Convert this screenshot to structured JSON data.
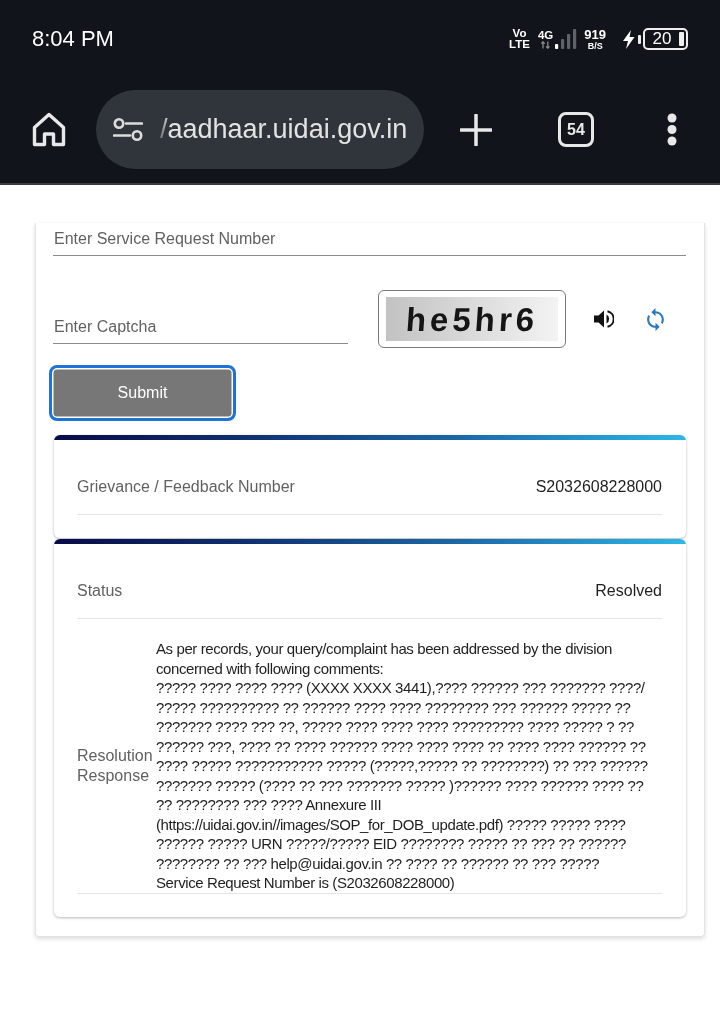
{
  "status_bar": {
    "time": "8:04 PM",
    "volte_top": "Vo",
    "volte_bottom": "LTE",
    "network_type": "4G",
    "speed_value": "919",
    "speed_unit": "B/S",
    "charging": true,
    "battery": "20"
  },
  "browser_toolbar": {
    "url": "/aadhaar.uidai.gov.in",
    "tab_count": "54"
  },
  "form": {
    "service_request_field": {
      "placeholder": "Enter Service Request Number"
    },
    "captcha_field": {
      "placeholder": "Enter Captcha"
    },
    "captcha_image_text": "he5hr6",
    "submit_button": {
      "label": "Submit",
      "focused": true
    }
  },
  "result_cards": [
    {
      "rows": [
        {
          "kind": "pair",
          "label": "Grievance / Feedback Number",
          "value": "S2032608228000"
        }
      ]
    },
    {
      "rows": [
        {
          "kind": "pair",
          "label": "Status",
          "value": "Resolved"
        },
        {
          "kind": "long_text",
          "label": "Resolution Response",
          "paragraphs": [
            "As per records, your query/complaint has been addressed by the division concerned with following comments:",
            "????? ???? ???? ???? (XXXX XXXX 3441),???? ?????? ??? ??????? ????/ ????? ?????????? ?? ?????? ???? ???? ???????? ??? ?????? ????? ?? ??????? ???? ??? ??, ????? ???? ???? ???? ????????? ???? ????? ? ?? ?????? ???, ???? ?? ???? ?????? ???? ???? ???? ?? ???? ???? ?????? ?? ???? ????? ??????????? ????? (?????,????? ?? ????????) ?? ??? ?????? ??????? ????? (???? ?? ??? ??????? ????? )?????? ???? ?????? ???? ?? ?? ???????? ??? ???? Annexure III (https://uidai.gov.in//images/SOP_for_DOB_update.pdf) ????? ????? ???? ?????? ????? URN ?????/????? EID ???????? ????? ?? ??? ?? ?????? ???????? ?? ??? help@uidai.gov.in ?? ???? ?? ?????? ?? ??? ?????",
            "Service Request Number is (S2032608228000)"
          ]
        }
      ]
    }
  ]
}
